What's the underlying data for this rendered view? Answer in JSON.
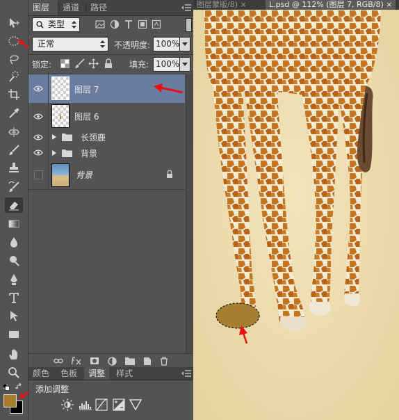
{
  "document_tabs": [
    {
      "label": "图层蒙版/8) ×",
      "active": false
    },
    {
      "label": "L.psd @ 112% (图层 7, RGB/8) ×",
      "active": true
    }
  ],
  "layers_panel": {
    "tabs": [
      "图层",
      "通道",
      "路径"
    ],
    "active_tab": "图层",
    "filter_kind": "类型",
    "blend_mode": "正常",
    "opacity_label": "不透明度:",
    "opacity_value": "100%",
    "lock_label": "锁定:",
    "fill_label": "填充:",
    "fill_value": "100%",
    "layers": [
      {
        "name": "图层 7",
        "visible": true,
        "selected": true,
        "type": "layer"
      },
      {
        "name": "图层 6",
        "visible": true,
        "selected": false,
        "type": "layer"
      },
      {
        "name": "长颈鹿",
        "visible": true,
        "selected": false,
        "type": "group"
      },
      {
        "name": "背景",
        "visible": true,
        "selected": false,
        "type": "group"
      },
      {
        "name": "背景",
        "visible": false,
        "selected": false,
        "type": "locked-background"
      }
    ]
  },
  "adjustments_panel": {
    "tabs": [
      "颜色",
      "色板",
      "调整",
      "样式"
    ],
    "active_tab": "调整",
    "title": "添加调整"
  },
  "colors": {
    "foreground": "#a87d2c",
    "background": "#000000",
    "selection_fill": "#a67e32",
    "annotation_arrow": "#e81010",
    "canvas_bg": "#efe0b6"
  }
}
